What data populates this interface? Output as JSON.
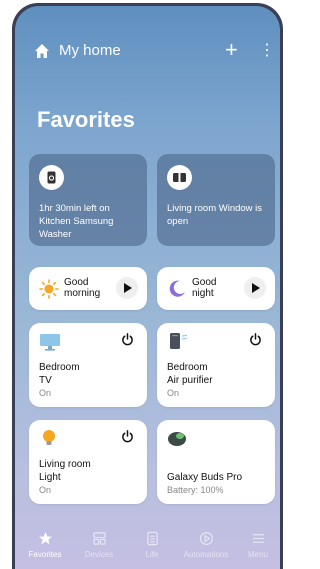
{
  "header": {
    "title": "My home"
  },
  "page_title": "Favorites",
  "status_cards": [
    {
      "text": "1hr 30min left on Kitchen Samsung Washer"
    },
    {
      "text": "Living room Window is open"
    }
  ],
  "routines": [
    {
      "line1": "Good",
      "line2": "morning"
    },
    {
      "line1": "Good",
      "line2": "night"
    }
  ],
  "devices": [
    {
      "line1": "Bedroom",
      "line2": "TV",
      "status": "On"
    },
    {
      "line1": "Bedroom",
      "line2": "Air purifier",
      "status": "On"
    },
    {
      "line1": "Living room",
      "line2": "Light",
      "status": "On"
    },
    {
      "line1": "Galaxy Buds Pro",
      "line2": "",
      "status": "Battery: 100%"
    }
  ],
  "nav": [
    {
      "label": "Favorites",
      "icon": "star-icon",
      "active": true
    },
    {
      "label": "Devices",
      "icon": "devices-icon",
      "active": false
    },
    {
      "label": "Life",
      "icon": "life-icon",
      "active": false
    },
    {
      "label": "Automations",
      "icon": "automations-icon",
      "active": false
    },
    {
      "label": "Menu",
      "icon": "menu-icon",
      "active": false
    }
  ],
  "colors": {
    "accent": "#ffffff",
    "sun": "#f5a623",
    "moon": "#8b6fd6",
    "tv": "#8ec5e8"
  }
}
